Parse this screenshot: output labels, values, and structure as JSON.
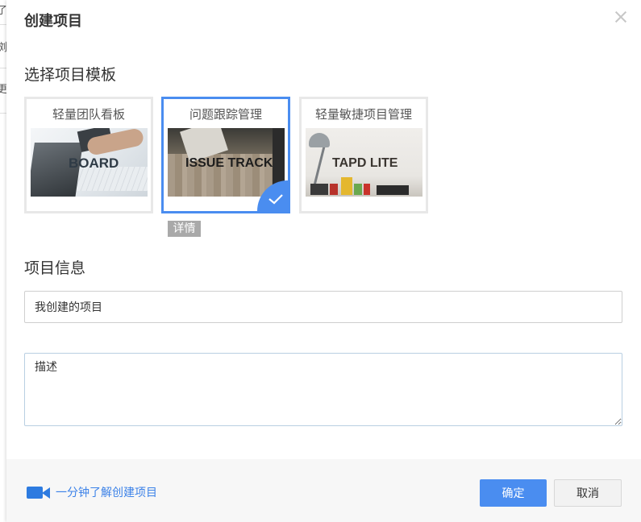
{
  "background": {
    "glyphs": [
      "了",
      "浏",
      "更"
    ]
  },
  "modal": {
    "title": "创建项目",
    "close_icon": "close-icon"
  },
  "templates": {
    "section_title": "选择项目模板",
    "items": [
      {
        "label": "轻量团队看板",
        "image_text": "BOARD",
        "selected": false
      },
      {
        "label": "问题跟踪管理",
        "image_text": "ISSUE TRACK",
        "selected": true
      },
      {
        "label": "轻量敏捷项目管理",
        "image_text": "TAPD LITE",
        "selected": false
      }
    ],
    "detail_label": "详情"
  },
  "info": {
    "section_title": "项目信息",
    "name_value": "我创建的项目",
    "desc_placeholder": "描述"
  },
  "footer": {
    "video_icon": "video-camera-icon",
    "video_link": "一分钟了解创建项目",
    "ok_label": "确定",
    "cancel_label": "取消"
  },
  "colors": {
    "accent": "#4a8df0",
    "link": "#3c82e8",
    "tag_gray": "#a9a9a9"
  }
}
